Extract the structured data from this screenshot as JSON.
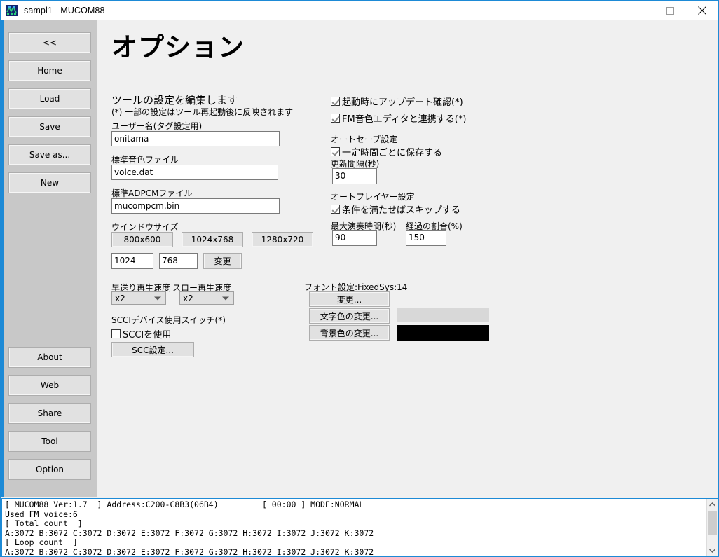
{
  "window": {
    "title": "sampl1 - MUCOM88",
    "icon": "app-icon",
    "minimize_label": "Minimize",
    "maximize_label": "Maximize",
    "close_label": "Close"
  },
  "sidebar": {
    "top_items": [
      {
        "label": "<<",
        "name": "collapse"
      },
      {
        "label": "Home",
        "name": "home"
      },
      {
        "label": "Load",
        "name": "load"
      },
      {
        "label": "Save",
        "name": "save"
      },
      {
        "label": "Save as...",
        "name": "save-as"
      },
      {
        "label": "New",
        "name": "new"
      }
    ],
    "bottom_items": [
      {
        "label": "About",
        "name": "about"
      },
      {
        "label": "Web",
        "name": "web"
      },
      {
        "label": "Share",
        "name": "share"
      },
      {
        "label": "Tool",
        "name": "tool"
      },
      {
        "label": "Option",
        "name": "option"
      }
    ]
  },
  "page": {
    "title": "オプション",
    "description_line1": "ツールの設定を編集します",
    "description_line2": "(*) 一部の設定はツール再起動後に反映されます"
  },
  "left_column": {
    "username_label": "ユーザー名(タグ設定用)",
    "username_value": "onitama",
    "voice_file_label": "標準音色ファイル",
    "voice_file_value": "voice.dat",
    "adpcm_file_label": "標準ADPCMファイル",
    "adpcm_file_value": "mucompcm.bin",
    "window_size_label": "ウインドウサイズ",
    "preset_800": "800x600",
    "preset_1024": "1024x768",
    "preset_1280": "1280x720",
    "width_value": "1024",
    "height_value": "768",
    "apply_label": "変更",
    "fastforward_label": "早送り再生速度",
    "fastforward_value": "x2",
    "slow_label": "スロー再生速度",
    "slow_value": "x2",
    "scci_group_label": "SCCIデバイス使用スイッチ(*)",
    "scci_checkbox_label": "SCCIを使用",
    "scci_checked": false,
    "scci_settings_label": "SCC設定..."
  },
  "right_column": {
    "update_check_label": "起動時にアップデート確認(*)",
    "update_check_checked": true,
    "fm_editor_label": "FM音色エディタと連携する(*)",
    "fm_editor_checked": true,
    "autosave_group_label": "オートセーブ設定",
    "autosave_checkbox_label": "一定時間ごとに保存する",
    "autosave_checked": true,
    "interval_label": "更新間隔(秒)",
    "interval_value": "30",
    "autoplayer_group_label": "オートプレイヤー設定",
    "skip_checkbox_label": "条件を満たせばスキップする",
    "skip_checked": true,
    "maxtime_label": "最大演奏時間(秒)",
    "maxtime_value": "90",
    "ratio_label": "経過の割合(%)",
    "ratio_value": "150",
    "font_setting_label": "フォント設定:FixedSys:14",
    "font_change_label": "変更...",
    "text_color_label": "文字色の変更...",
    "text_color_value": "#d8d8d8",
    "bg_color_label": "背景色の変更...",
    "bg_color_value": "#000000"
  },
  "console": {
    "line1": "[ MUCOM88 Ver:1.7  ] Address:C200-C8B3(06B4)         [ 00:00 ] MODE:NORMAL",
    "line2": "Used FM voice:6",
    "line3": "[ Total count  ]",
    "line4": "A:3072 B:3072 C:3072 D:3072 E:3072 F:3072 G:3072 H:3072 I:3072 J:3072 K:3072",
    "line5": "[ Loop count  ]",
    "line6": "A:3072 B:3072 C:3072 D:3072 E:3072 F:3072 G:3072 H:3072 I:3072 J:3072 K:3072",
    "scroll_up_icon": "chevron-up-icon",
    "scroll_down_icon": "chevron-down-icon"
  },
  "colors": {
    "accent": "#1d8ad6",
    "sidebar_bg": "#c8c8c8",
    "content_bg": "#f0f0f0",
    "button_bg": "#e1e1e1"
  }
}
